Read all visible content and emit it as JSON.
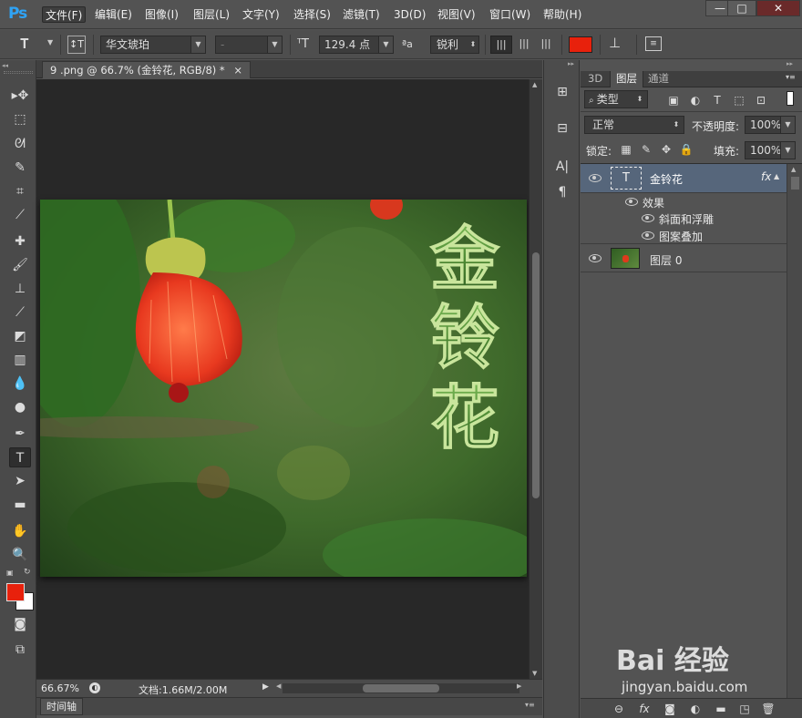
{
  "app": {
    "logo": "Ps"
  },
  "menu": [
    "文件(F)",
    "编辑(E)",
    "图像(I)",
    "图层(L)",
    "文字(Y)",
    "选择(S)",
    "滤镜(T)",
    "3D(D)",
    "视图(V)",
    "窗口(W)",
    "帮助(H)"
  ],
  "window_controls": {
    "minimize": "—",
    "maximize": "□",
    "close": "✕"
  },
  "options": {
    "font_family": "华文琥珀",
    "font_style": "-",
    "font_size": "129.4 点",
    "aa_label": "ªa",
    "antialias": "锐利",
    "text_color": "#e8210c"
  },
  "document": {
    "tab_title": "9 .png @ 66.7% (金铃花, RGB/8) *",
    "close": "×"
  },
  "status": {
    "zoom": "66.67%",
    "doc_info": "文档:1.66M/2.00M"
  },
  "timeline": {
    "label": "时间轴"
  },
  "panel_tabs": [
    "3D",
    "图层",
    "通道"
  ],
  "layers_panel": {
    "filter_kind": "类型",
    "blend_mode": "正常",
    "opacity_label": "不透明度:",
    "opacity": "100%",
    "lock_label": "锁定:",
    "fill_label": "填充:",
    "fill": "100%",
    "layers": [
      {
        "name": "金铃花",
        "type": "text",
        "fx": "fx",
        "thumb_glyph": "T"
      },
      {
        "name": "效果",
        "kind": "effects-header"
      },
      {
        "name": "斜面和浮雕",
        "kind": "effect"
      },
      {
        "name": "图案叠加",
        "kind": "effect"
      },
      {
        "name": "图层 0",
        "type": "image"
      }
    ]
  },
  "canvas_text": "金铃花",
  "watermark": {
    "brand": "Bai 经验",
    "url": "jingyan.baidu.com"
  },
  "colors": {
    "foreground": "#e8210c",
    "background": "#ffffff",
    "accent": "#2fa3f5"
  }
}
